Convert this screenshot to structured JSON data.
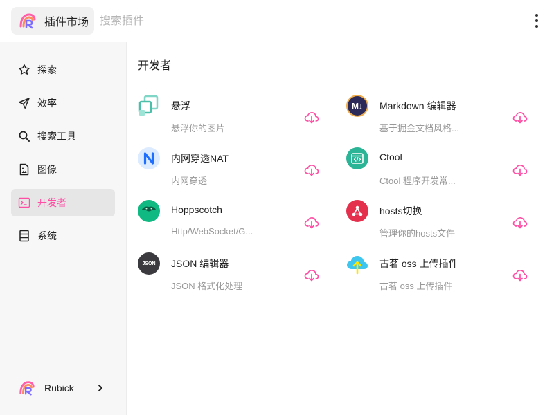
{
  "header": {
    "title": "插件市场",
    "search_placeholder": "搜索插件"
  },
  "sidebar": {
    "items": [
      {
        "label": "探索",
        "icon": "star-icon"
      },
      {
        "label": "效率",
        "icon": "send-icon"
      },
      {
        "label": "搜索工具",
        "icon": "search-icon"
      },
      {
        "label": "图像",
        "icon": "image-file-icon"
      },
      {
        "label": "开发者",
        "icon": "terminal-icon",
        "active": true
      },
      {
        "label": "系统",
        "icon": "system-icon"
      }
    ],
    "user": {
      "name": "Rubick"
    }
  },
  "main": {
    "section_title": "开发者",
    "plugins": [
      {
        "name": "悬浮",
        "desc": "悬浮你的图片",
        "icon": "float-icon"
      },
      {
        "name": "Markdown 编辑器",
        "desc": "基于掘金文档风格...",
        "icon": "markdown-icon"
      },
      {
        "name": "内网穿透NAT",
        "desc": "内网穿透",
        "icon": "nat-icon"
      },
      {
        "name": "Ctool",
        "desc": "Ctool 程序开发常...",
        "icon": "ctool-icon"
      },
      {
        "name": "Hoppscotch",
        "desc": "Http/WebSocket/G...",
        "icon": "hoppscotch-icon"
      },
      {
        "name": "hosts切换",
        "desc": "管理你的hosts文件",
        "icon": "hosts-icon"
      },
      {
        "name": "JSON 编辑器",
        "desc": "JSON 格式化处理",
        "icon": "json-icon",
        "icon_text": "JSON"
      },
      {
        "name": "古茗 oss 上传插件",
        "desc": "古茗 oss 上传插件",
        "icon": "cloud-upload-icon"
      }
    ]
  },
  "colors": {
    "accent": "#ff4ea4",
    "sidebar_bg": "#f7f7f7",
    "active_bg": "#e6e6e6"
  }
}
